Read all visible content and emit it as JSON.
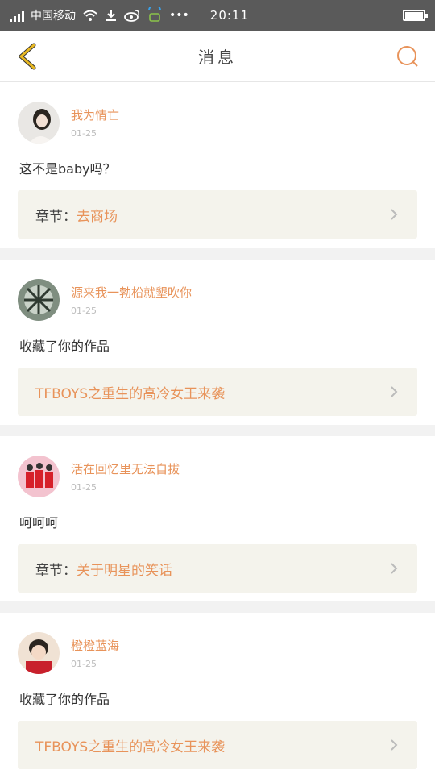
{
  "status_bar": {
    "carrier": "中国移动",
    "time": "20:11"
  },
  "header": {
    "title": "消息"
  },
  "messages": [
    {
      "user": "我为情亡",
      "date": "01-25",
      "content": "这不是baby吗？",
      "ref_prefix": "章节：",
      "ref_title": "去商场"
    },
    {
      "user": "源来我一勃柗就墾吹你",
      "date": "01-25",
      "content": "收藏了你的作品",
      "ref_prefix": "",
      "ref_title": "TFBOYS之重生的高冷女王来袭"
    },
    {
      "user": "活在回忆里无法自拔",
      "date": "01-25",
      "content": "呵呵呵",
      "ref_prefix": "章节：",
      "ref_title": "关于明星的笑话"
    },
    {
      "user": "橙橙蓝海",
      "date": "01-25",
      "content": "收藏了你的作品",
      "ref_prefix": "",
      "ref_title": "TFBOYS之重生的高冷女王来袭"
    }
  ],
  "colors": {
    "accent": "#e8935a",
    "back_arrow": "#e8b822",
    "ref_bg": "#f4f3ec"
  }
}
